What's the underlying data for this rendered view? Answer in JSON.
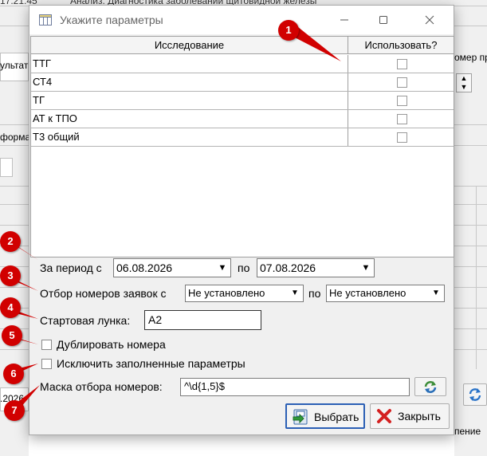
{
  "background": {
    "time_partial": "17:21:45",
    "analysis_partial": "Анализ:  Диагностика заболеваний щитовидной железы",
    "left_labels": [
      "ультат",
      "форма",
      ".2026"
    ],
    "right_labels": [
      "омер пр",
      "пение"
    ]
  },
  "dialog": {
    "title": "Укажите параметры",
    "table": {
      "col_study": "Исследование",
      "col_use": "Использовать?",
      "rows": [
        {
          "name": "ТТГ",
          "checked": false
        },
        {
          "name": "СТ4",
          "checked": false
        },
        {
          "name": "ТГ",
          "checked": false
        },
        {
          "name": "АТ к ТПО",
          "checked": false
        },
        {
          "name": "Т3 общий",
          "checked": false
        }
      ]
    },
    "period": {
      "label": "За период с",
      "from": "06.08.2026",
      "to_label": "по",
      "to": "07.08.2026"
    },
    "numbers": {
      "label": "Отбор номеров заявок с",
      "from": "Не установлено",
      "to_label": "по",
      "to": "Не установлено"
    },
    "start_well": {
      "label": "Стартовая лунка:",
      "value": "A2"
    },
    "duplicate": {
      "label": "Дублировать номера",
      "checked": false
    },
    "exclude": {
      "label": "Исключить заполненные параметры",
      "checked": false
    },
    "mask": {
      "label": "Маска отбора номеров:",
      "value": "^\\d{1,5}$"
    },
    "buttons": {
      "select": "Выбрать",
      "close": "Закрыть"
    }
  },
  "annotations": [
    "1",
    "2",
    "3",
    "4",
    "5",
    "6",
    "7"
  ],
  "colors": {
    "badge": "#d10000",
    "accent": "#2b5fb5"
  }
}
